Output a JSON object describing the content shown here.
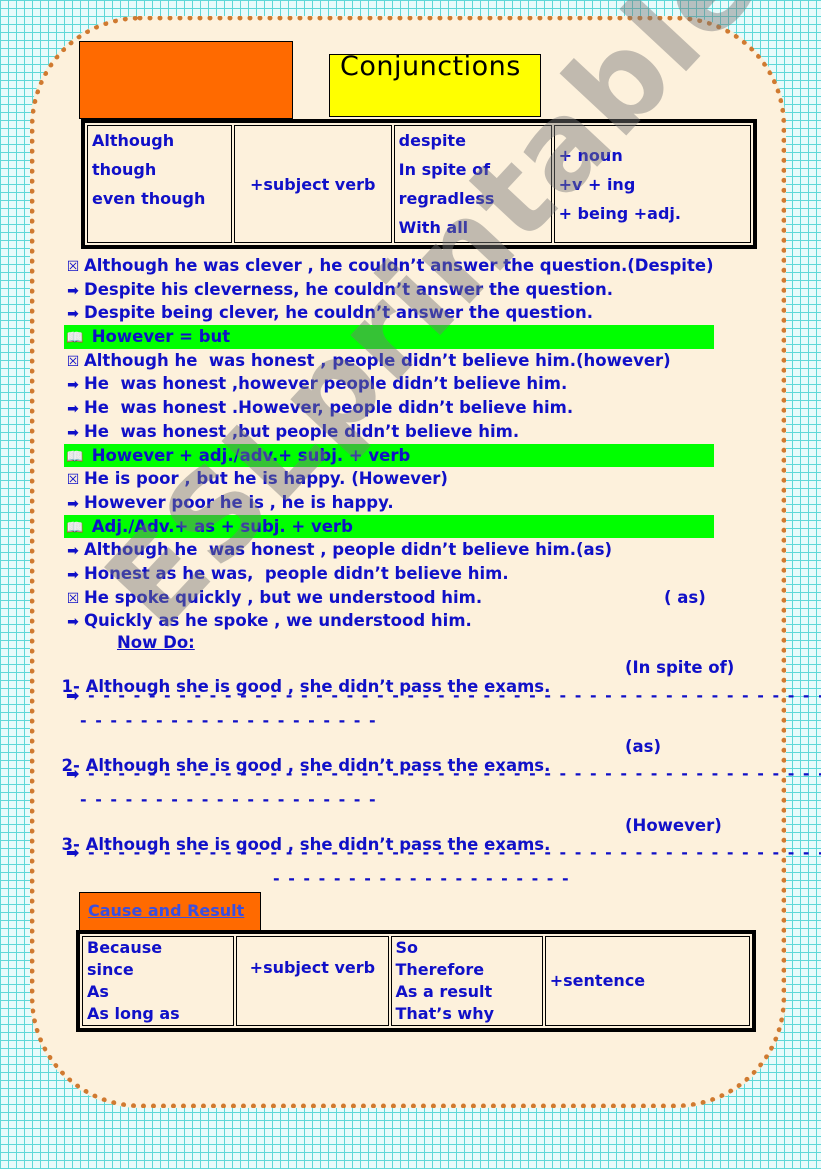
{
  "title": "Conjunctions",
  "table1": {
    "col1": [
      "Although",
      "though",
      "even though"
    ],
    "col2": "+subject verb",
    "col3": [
      "despite",
      "In spite of",
      "regradless",
      "With all"
    ],
    "col4": [
      "+ noun",
      "+v + ing",
      "+ being +adj."
    ]
  },
  "lines": [
    {
      "icon": "check-box-icon",
      "glyph": "☒",
      "text": "Although he was clever , he couldn’t answer the question.(Despite)",
      "highlight": false
    },
    {
      "icon": "arrow-right-icon",
      "glyph": "➡",
      "text": "Despite his cleverness, he couldn’t answer the question.",
      "highlight": false
    },
    {
      "icon": "arrow-right-icon",
      "glyph": "➡",
      "text": "Despite being clever, he couldn’t answer the question.",
      "highlight": false
    },
    {
      "icon": "book-icon",
      "glyph": "📖",
      "text": " However = but",
      "highlight": true
    },
    {
      "icon": "check-box-icon",
      "glyph": "☒",
      "text": "Although he  was honest , people didn’t believe him.(however)",
      "highlight": false
    },
    {
      "icon": "arrow-right-icon",
      "glyph": "➡",
      "text": "He  was honest ,however people didn’t believe him.",
      "highlight": false
    },
    {
      "icon": "arrow-right-icon",
      "glyph": "➡",
      "text": "He  was honest .However, people didn’t believe him.",
      "highlight": false
    },
    {
      "icon": "arrow-right-icon",
      "glyph": "➡",
      "text": "He  was honest ,but people didn’t believe him.",
      "highlight": false
    },
    {
      "icon": "book-icon",
      "glyph": "📖",
      "text": " However + adj./adv.+ subj. + verb",
      "highlight": true
    },
    {
      "icon": "check-box-icon",
      "glyph": "☒",
      "text": "He is poor , but he is happy. (However)",
      "highlight": false
    },
    {
      "icon": "arrow-right-icon",
      "glyph": "➡",
      "text": "However poor he is , he is happy.",
      "highlight": false
    },
    {
      "icon": "book-icon",
      "glyph": "📖",
      "text": " Adj./Adv.+ as + subj. + verb",
      "highlight": true
    },
    {
      "icon": "arrow-right-icon",
      "glyph": "➡",
      "text": "Although he  was honest , people didn’t believe him.(as)",
      "highlight": false
    },
    {
      "icon": "arrow-right-icon",
      "glyph": "➡",
      "text": "Honest as he was,  people didn’t believe him.",
      "highlight": false
    },
    {
      "icon": "check-box-icon",
      "glyph": "☒",
      "text": "He spoke quickly , but we understood him.",
      "note": "( as)",
      "highlight": false
    },
    {
      "icon": "arrow-right-icon",
      "glyph": "➡",
      "text": "Quickly as he spoke , we understood him.",
      "highlight": false
    }
  ],
  "now_do": "Now Do:",
  "exercises": [
    {
      "text": "1- Although she is good , she didn’t pass the exams.",
      "hint": "(In spite of)"
    },
    {
      "text": "2- Although she is good , she didn’t pass the exams.",
      "hint": "(as)"
    },
    {
      "text": "3- Although she is good , she didn’t pass the exams.",
      "hint": "(However)"
    }
  ],
  "answer_glyph": "➡",
  "dash_long": "- - - - - - - - - - - - - - - - - - - - - - - - - - - - - - - - - - - - - - - - - - - - - - - - - - - -",
  "dash_short": "- - - - - - - - - - - - - - - - - - - -",
  "cause_title": "Cause and Result",
  "table2": {
    "col1": [
      "Because",
      "since",
      "As",
      "As long as"
    ],
    "col2": "+subject verb",
    "col3": [
      "So",
      "Therefore",
      "As a result",
      "That’s why"
    ],
    "col4": "+sentence"
  },
  "watermark": "ESLprintables.com"
}
